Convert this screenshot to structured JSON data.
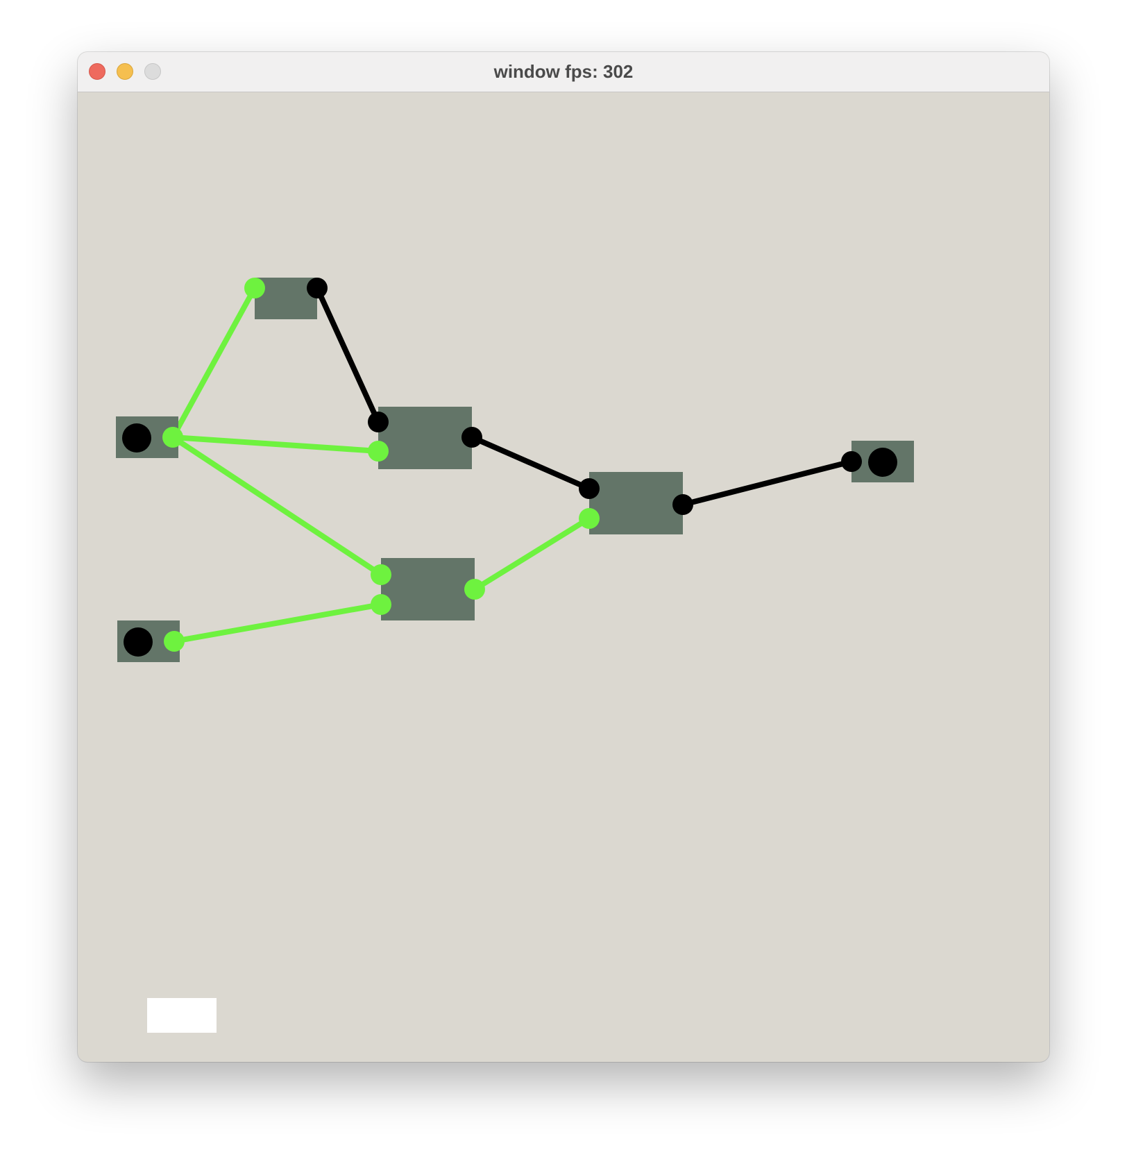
{
  "window": {
    "title": "window fps: 302",
    "background_color": "#dbd8d0",
    "controls": [
      "close",
      "minimize",
      "zoom"
    ]
  },
  "graph": {
    "node_color": "#637568",
    "active_color": "#6ef23f",
    "inactive_color": "#000000",
    "text_input_color": "#ffffff",
    "nodes": [
      {
        "id": "input-node-1",
        "kind": "input"
      },
      {
        "id": "input-node-2",
        "kind": "input"
      },
      {
        "id": "gate-node-top",
        "kind": "gate"
      },
      {
        "id": "gate-node-middle",
        "kind": "gate"
      },
      {
        "id": "gate-node-lower",
        "kind": "gate"
      },
      {
        "id": "gate-node-right",
        "kind": "gate"
      },
      {
        "id": "output-node",
        "kind": "output"
      }
    ],
    "wires": [
      {
        "id": "wire-input1-gatetop",
        "active": true
      },
      {
        "id": "wire-input1-gatemiddle",
        "active": true
      },
      {
        "id": "wire-input1-gatelower",
        "active": true
      },
      {
        "id": "wire-input2-gatelower",
        "active": true
      },
      {
        "id": "wire-gatetop-gatemiddle",
        "active": false
      },
      {
        "id": "wire-gatemiddle-gateright",
        "active": false
      },
      {
        "id": "wire-gatelower-gateright",
        "active": true
      },
      {
        "id": "wire-gateright-output",
        "active": false
      }
    ]
  }
}
